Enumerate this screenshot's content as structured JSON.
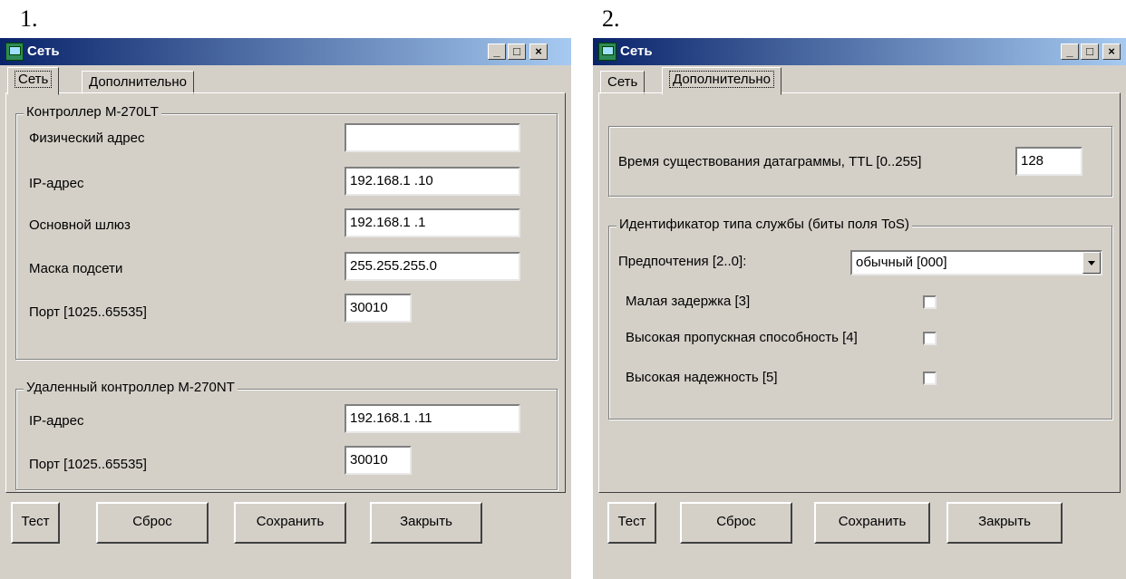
{
  "panel_labels": [
    "1.",
    "2."
  ],
  "window1": {
    "title": "Сеть",
    "controls": [
      "_",
      "□",
      "×"
    ],
    "tabs": [
      "Сеть",
      "Дополнительно"
    ],
    "group1": {
      "title": "Контроллер М-270LT",
      "rows": [
        {
          "label": "Физический адрес",
          "value": ""
        },
        {
          "label": "IP-адрес",
          "value": "192.168.1  .10"
        },
        {
          "label": "Основной шлюз",
          "value": "192.168.1  .1"
        },
        {
          "label": "Маска подсети",
          "value": "255.255.255.0"
        },
        {
          "label": "Порт [1025..65535]",
          "value": "30010"
        }
      ]
    },
    "group2": {
      "title": "Удаленный контроллер М-270NT",
      "rows": [
        {
          "label": "IP-адрес",
          "value": "192.168.1  .11"
        },
        {
          "label": "Порт [1025..65535]",
          "value": "30010"
        }
      ]
    },
    "buttons": [
      "Тест",
      "Сброс",
      "Сохранить",
      "Закрыть"
    ]
  },
  "window2": {
    "title": "Сеть",
    "controls": [
      "_",
      "□",
      "×"
    ],
    "tabs": [
      "Сеть",
      "Дополнительно"
    ],
    "ttl": {
      "label": "Время существования датаграммы, TTL [0..255]",
      "value": "128"
    },
    "tos_group": {
      "title": "Идентификатор типа службы (биты поля ToS)",
      "pref_label": "Предпочтения [2..0]:",
      "pref_value": "обычный [000]",
      "checks": [
        {
          "label": "Малая задержка [3]",
          "checked": false
        },
        {
          "label": "Высокая пропускная способность [4]",
          "checked": false
        },
        {
          "label": "Высокая надежность [5]",
          "checked": false
        }
      ]
    },
    "buttons": [
      "Тест",
      "Сброс",
      "Сохранить",
      "Закрыть"
    ]
  },
  "colors": {
    "titlebar_start": "#0a246a",
    "titlebar_end": "#a6caf0",
    "face": "#d4d0c8"
  }
}
